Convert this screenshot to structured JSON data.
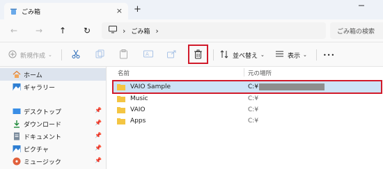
{
  "titlebar": {
    "tab_title": "ごみ箱",
    "close_tab_glyph": "×",
    "new_tab_glyph": "+",
    "icons": {
      "tab": "recycle-bin-icon",
      "minimize": "minimize-icon"
    }
  },
  "address": {
    "back_glyph": "←",
    "forward_glyph": "→",
    "up_glyph": "↑",
    "refresh_glyph": "↻",
    "breadcrumb_sep": "›",
    "path_label": "ごみ箱",
    "search_placeholder": "ごみ箱の検索"
  },
  "toolbar": {
    "new_label": "新規作成",
    "sort_label": "並べ替え",
    "view_label": "表示",
    "more_label": "•••",
    "icons": [
      "plus-icon",
      "cut-icon",
      "copy-icon",
      "paste-icon",
      "rename-icon",
      "share-icon",
      "delete-icon",
      "sort-icon",
      "view-icon"
    ]
  },
  "sidebar": {
    "items": [
      {
        "label": "ホーム",
        "icon": "home-icon"
      },
      {
        "label": "ギャラリー",
        "icon": "gallery-icon"
      },
      {
        "label": "デスクトップ",
        "icon": "desktop-icon"
      },
      {
        "label": "ダウンロード",
        "icon": "download-icon"
      },
      {
        "label": "ドキュメント",
        "icon": "document-icon"
      },
      {
        "label": "ピクチャ",
        "icon": "pictures-icon"
      },
      {
        "label": "ミュージック",
        "icon": "music-icon"
      }
    ]
  },
  "list": {
    "columns": [
      "名前",
      "元の場所"
    ],
    "rows": [
      {
        "name": "VAIO Sample",
        "location": "C:¥"
      },
      {
        "name": "Music",
        "location": "C:¥"
      },
      {
        "name": "VAIO",
        "location": "C:¥"
      },
      {
        "name": "Apps",
        "location": "C:¥"
      }
    ]
  },
  "colors": {
    "accent_highlight": "#d11a2a",
    "folder": "#f4c542",
    "selection": "#cde3f6"
  }
}
